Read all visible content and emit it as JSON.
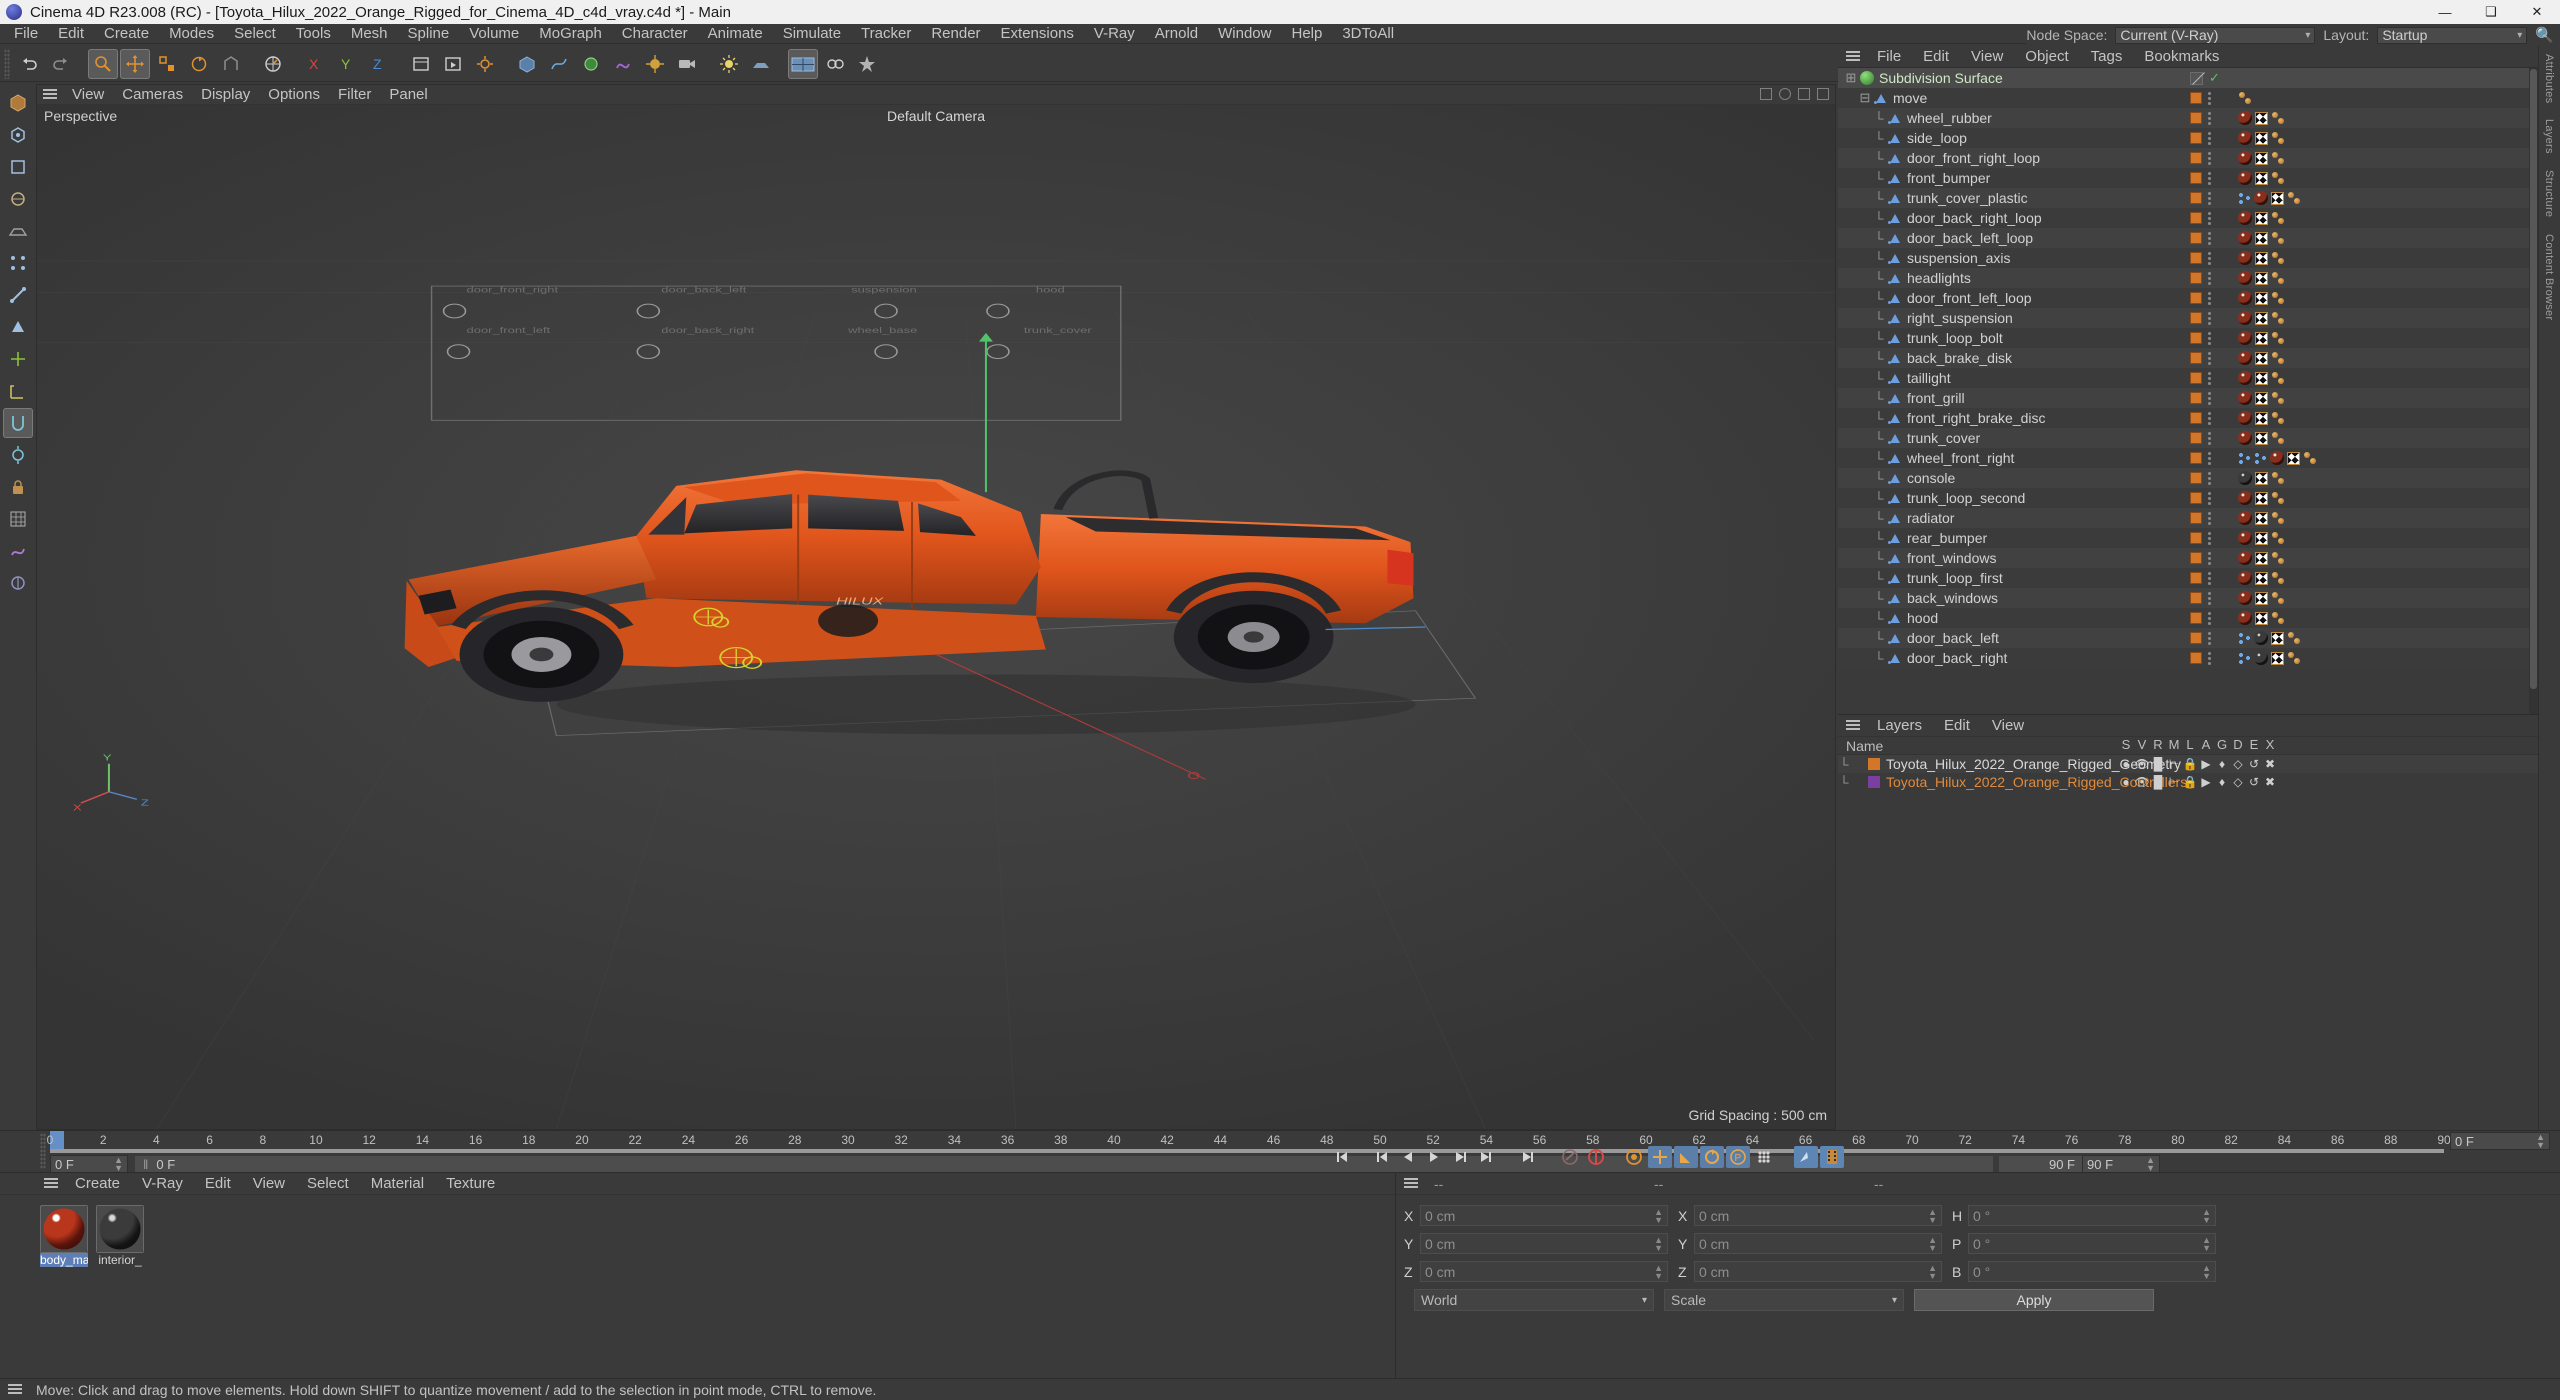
{
  "window": {
    "title": "Cinema 4D R23.008 (RC) - [Toyota_Hilux_2022_Orange_Rigged_for_Cinema_4D_c4d_vray.c4d *] - Main",
    "minimize": "—",
    "maximize": "❑",
    "close": "✕"
  },
  "menubar": {
    "items": [
      "File",
      "Edit",
      "Create",
      "Modes",
      "Select",
      "Tools",
      "Mesh",
      "Spline",
      "Volume",
      "MoGraph",
      "Character",
      "Animate",
      "Simulate",
      "Tracker",
      "Render",
      "Extensions",
      "V-Ray",
      "Arnold",
      "Window",
      "Help",
      "3DToAll"
    ]
  },
  "nodespace": {
    "label": "Node Space:",
    "value": "Current (V-Ray)",
    "layout_label": "Layout:",
    "layout_value": "Startup",
    "search_icon": "search-icon"
  },
  "viewport": {
    "menus": [
      "View",
      "Cameras",
      "Display",
      "Options",
      "Filter",
      "Panel"
    ],
    "label": "Perspective",
    "camera": "Default Camera",
    "grid_spacing": "Grid Spacing : 500 cm"
  },
  "object_manager": {
    "menus": [
      "File",
      "Edit",
      "View",
      "Object",
      "Tags",
      "Bookmarks"
    ],
    "rows": [
      {
        "name": "Subdivision Surface",
        "icon": "subdivision-surface-icon",
        "indent": 0,
        "tags": [
          "slash",
          "check"
        ]
      },
      {
        "name": "move",
        "icon": "null-object-icon",
        "indent": 1,
        "tags": [
          "square",
          "dots",
          "balls"
        ]
      },
      {
        "name": "wheel_rubber",
        "icon": "null-object-icon",
        "indent": 2,
        "tags": [
          "square",
          "dots",
          "mat",
          "uv",
          "balls"
        ]
      },
      {
        "name": "side_loop",
        "icon": "null-object-icon",
        "indent": 2,
        "tags": [
          "square",
          "dots",
          "mat",
          "uv",
          "balls"
        ]
      },
      {
        "name": "door_front_right_loop",
        "icon": "null-object-icon",
        "indent": 2,
        "tags": [
          "square",
          "dots",
          "mat",
          "uv",
          "balls"
        ]
      },
      {
        "name": "front_bumper",
        "icon": "null-object-icon",
        "indent": 2,
        "tags": [
          "square",
          "dots",
          "mat",
          "uv",
          "balls"
        ]
      },
      {
        "name": "trunk_cover_plastic",
        "icon": "null-object-icon",
        "indent": 2,
        "tags": [
          "square",
          "dots",
          "xp",
          "mat",
          "uv",
          "balls"
        ]
      },
      {
        "name": "door_back_right_loop",
        "icon": "null-object-icon",
        "indent": 2,
        "tags": [
          "square",
          "dots",
          "mat",
          "uv",
          "balls"
        ]
      },
      {
        "name": "door_back_left_loop",
        "icon": "null-object-icon",
        "indent": 2,
        "tags": [
          "square",
          "dots",
          "mat",
          "uv",
          "balls"
        ]
      },
      {
        "name": "suspension_axis",
        "icon": "null-object-icon",
        "indent": 2,
        "tags": [
          "square",
          "dots",
          "mat",
          "uv",
          "balls"
        ]
      },
      {
        "name": "headlights",
        "icon": "null-object-icon",
        "indent": 2,
        "tags": [
          "square",
          "dots",
          "mat",
          "uv",
          "balls"
        ]
      },
      {
        "name": "door_front_left_loop",
        "icon": "null-object-icon",
        "indent": 2,
        "tags": [
          "square",
          "dots",
          "mat",
          "uv",
          "balls"
        ]
      },
      {
        "name": "right_suspension",
        "icon": "null-object-icon",
        "indent": 2,
        "tags": [
          "square",
          "dots",
          "mat",
          "uv",
          "balls"
        ]
      },
      {
        "name": "trunk_loop_bolt",
        "icon": "null-object-icon",
        "indent": 2,
        "tags": [
          "square",
          "dots",
          "mat",
          "uv",
          "balls"
        ]
      },
      {
        "name": "back_brake_disk",
        "icon": "null-object-icon",
        "indent": 2,
        "tags": [
          "square",
          "dots",
          "mat",
          "uv",
          "balls"
        ]
      },
      {
        "name": "taillight",
        "icon": "null-object-icon",
        "indent": 2,
        "tags": [
          "square",
          "dots",
          "mat",
          "uv",
          "balls"
        ]
      },
      {
        "name": "front_grill",
        "icon": "null-object-icon",
        "indent": 2,
        "tags": [
          "square",
          "dots",
          "mat",
          "uv",
          "balls"
        ]
      },
      {
        "name": "front_right_brake_disc",
        "icon": "null-object-icon",
        "indent": 2,
        "tags": [
          "square",
          "dots",
          "mat",
          "uv",
          "balls"
        ]
      },
      {
        "name": "trunk_cover",
        "icon": "null-object-icon",
        "indent": 2,
        "tags": [
          "square",
          "dots",
          "mat",
          "uv",
          "balls"
        ]
      },
      {
        "name": "wheel_front_right",
        "icon": "null-object-icon",
        "indent": 2,
        "tags": [
          "square",
          "dots",
          "xp",
          "xp",
          "mat",
          "uv",
          "balls"
        ]
      },
      {
        "name": "console",
        "icon": "null-object-icon",
        "indent": 2,
        "tags": [
          "square",
          "dots",
          "matdark",
          "uv",
          "balls"
        ]
      },
      {
        "name": "trunk_loop_second",
        "icon": "null-object-icon",
        "indent": 2,
        "tags": [
          "square",
          "dots",
          "mat",
          "uv",
          "balls"
        ]
      },
      {
        "name": "radiator",
        "icon": "null-object-icon",
        "indent": 2,
        "tags": [
          "square",
          "dots",
          "mat",
          "uv",
          "balls"
        ]
      },
      {
        "name": "rear_bumper",
        "icon": "null-object-icon",
        "indent": 2,
        "tags": [
          "square",
          "dots",
          "mat",
          "uv",
          "balls"
        ]
      },
      {
        "name": "front_windows",
        "icon": "null-object-icon",
        "indent": 2,
        "tags": [
          "square",
          "dots",
          "mat",
          "uv",
          "balls"
        ]
      },
      {
        "name": "trunk_loop_first",
        "icon": "null-object-icon",
        "indent": 2,
        "tags": [
          "square",
          "dots",
          "mat",
          "uv",
          "balls"
        ]
      },
      {
        "name": "back_windows",
        "icon": "null-object-icon",
        "indent": 2,
        "tags": [
          "square",
          "dots",
          "mat",
          "uv",
          "balls"
        ]
      },
      {
        "name": "hood",
        "icon": "null-object-icon",
        "indent": 2,
        "tags": [
          "square",
          "dots",
          "mat",
          "uv",
          "balls"
        ]
      },
      {
        "name": "door_back_left",
        "icon": "null-object-icon",
        "indent": 2,
        "tags": [
          "square",
          "dots",
          "xp",
          "matdark",
          "uv",
          "balls"
        ]
      },
      {
        "name": "door_back_right",
        "icon": "null-object-icon",
        "indent": 2,
        "tags": [
          "square",
          "dots",
          "xp",
          "matdark",
          "uv",
          "balls"
        ]
      }
    ]
  },
  "layers": {
    "menus": [
      "Layers",
      "Edit",
      "View"
    ],
    "name_header": "Name",
    "columns": [
      "S",
      "V",
      "R",
      "M",
      "L",
      "A",
      "G",
      "D",
      "E",
      "X"
    ],
    "rows": [
      {
        "name": "Toyota_Hilux_2022_Orange_Rigged_Geometry",
        "color": "#d2762a",
        "text_color": "#d8d8d8"
      },
      {
        "name": "Toyota_Hilux_2022_Orange_Rigged_Controllers",
        "color": "#7a3fa0",
        "text_color": "#e08a3c"
      }
    ]
  },
  "edge_tabs": [
    "Attributes",
    "Layers",
    "Structure",
    "Content Browser"
  ],
  "timeline": {
    "ticks": [
      "0",
      "2",
      "4",
      "6",
      "8",
      "10",
      "12",
      "14",
      "16",
      "18",
      "20",
      "22",
      "24",
      "26",
      "28",
      "30",
      "32",
      "34",
      "36",
      "38",
      "40",
      "42",
      "44",
      "46",
      "48",
      "50",
      "52",
      "54",
      "56",
      "58",
      "60",
      "62",
      "64",
      "66",
      "68",
      "70",
      "72",
      "74",
      "76",
      "78",
      "80",
      "82",
      "84",
      "86",
      "88",
      "90"
    ],
    "current_frame_right": "0 F",
    "start_field": "0 F",
    "preview_field": "0 F",
    "end_field_left": "90 F",
    "end_field_right": "90 F"
  },
  "materials": {
    "menus": [
      "Create",
      "V-Ray",
      "Edit",
      "View",
      "Select",
      "Material",
      "Texture"
    ],
    "items": [
      {
        "label": "body_ma",
        "selected": true
      },
      {
        "label": "interior_",
        "selected": false
      }
    ]
  },
  "coordinates": {
    "header": [
      "--",
      "--",
      "--"
    ],
    "position": {
      "labels": [
        "X",
        "Y",
        "Z"
      ],
      "values": [
        "0 cm",
        "0 cm",
        "0 cm"
      ]
    },
    "size": {
      "labels": [
        "X",
        "Y",
        "Z"
      ],
      "values": [
        "0 cm",
        "0 cm",
        "0 cm"
      ]
    },
    "rotation": {
      "labels": [
        "H",
        "P",
        "B"
      ],
      "values": [
        "0 °",
        "0 °",
        "0 °"
      ]
    },
    "system": "World",
    "mode": "Scale",
    "apply": "Apply"
  },
  "statusbar": {
    "message": "Move: Click and drag to move elements. Hold down SHIFT to quantize movement / add to the selection in point mode, CTRL to remove."
  },
  "colors": {
    "accent_orange": "#d2762a",
    "layer_purple": "#7a3fa0",
    "selection_blue": "#5e7fb5",
    "body_orange": "#e05a1e",
    "ui_bg": "#3a3a3a"
  }
}
